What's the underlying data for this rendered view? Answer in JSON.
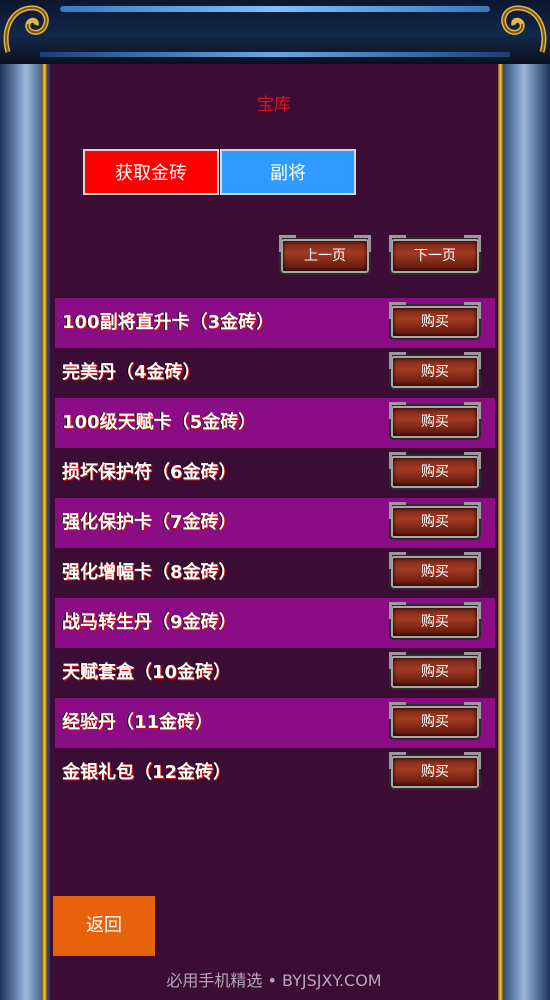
{
  "header": {
    "title": "宝库"
  },
  "tabs": [
    {
      "label": "获取金砖",
      "color": "#ff0000"
    },
    {
      "label": "副将",
      "color": "#2f9bff"
    }
  ],
  "pagination": {
    "prev_label": "上一页",
    "next_label": "下一页"
  },
  "items": [
    {
      "name": "100副将直升卡（3金砖）",
      "buy_label": "购买"
    },
    {
      "name": "完美丹（4金砖）",
      "buy_label": "购买"
    },
    {
      "name": "100级天赋卡（5金砖）",
      "buy_label": "购买"
    },
    {
      "name": "损坏保护符（6金砖）",
      "buy_label": "购买"
    },
    {
      "name": "强化保护卡（7金砖）",
      "buy_label": "购买"
    },
    {
      "name": "强化增幅卡（8金砖）",
      "buy_label": "购买"
    },
    {
      "name": "战马转生丹（9金砖）",
      "buy_label": "购买"
    },
    {
      "name": "天赋套盒（10金砖）",
      "buy_label": "购买"
    },
    {
      "name": "经验丹（11金砖）",
      "buy_label": "购买"
    },
    {
      "name": "金银礼包（12金砖）",
      "buy_label": "购买"
    }
  ],
  "footer": {
    "back_label": "返回",
    "watermark": "必用手机精选 • BYJSJXY.COM"
  },
  "colors": {
    "panel": "#3b0d34",
    "row_highlight": "#8a0d86",
    "title": "#e0141a",
    "back_button": "#e8620c"
  }
}
